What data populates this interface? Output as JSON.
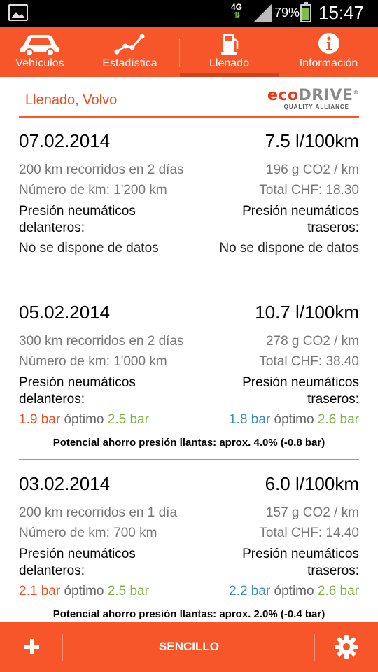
{
  "status_bar": {
    "network": "4G",
    "battery_percent": "79%",
    "battery_level": 0.79,
    "time": "15:47",
    "icons": [
      "image-notification-icon",
      "signal-icon",
      "battery-icon"
    ]
  },
  "nav": {
    "tabs": [
      {
        "label": "Vehículos",
        "icon": "car-icon",
        "active": false
      },
      {
        "label": "Estadística",
        "icon": "line-chart-icon",
        "active": false
      },
      {
        "label": "Llenado",
        "icon": "fuel-pump-icon",
        "active": true
      },
      {
        "label": "Información",
        "icon": "info-icon",
        "active": false
      }
    ]
  },
  "header": {
    "title": "Llenado, Volvo",
    "logo_text_red": "eco",
    "logo_text_grey": "DRIVE",
    "logo_registered": "®",
    "logo_sub": "QUALITY ALLIANCE"
  },
  "entries": [
    {
      "date": "07.02.2014",
      "consumption": "7.5 l/100km",
      "distance": "200 km recorridos en 2 días",
      "co2": "196 g CO2 / km",
      "odometer": "Número de km: 1'200 km",
      "total": "Total CHF: 18.30",
      "front_label_1": "Presión neumáticos",
      "front_label_2": "delanteros:",
      "rear_label_1": "Presión neumáticos",
      "rear_label_2": "traseros:",
      "front_value": "No se dispone de datos",
      "rear_value": "No se dispone de datos"
    },
    {
      "date": "05.02.2014",
      "consumption": "10.7 l/100km",
      "distance": "300 km recorridos en 2 días",
      "co2": "278 g CO2 / km",
      "odometer": "Número de km: 1'000 km",
      "total": "Total CHF: 38.40",
      "front_label_1": "Presión neumáticos",
      "front_label_2": "delanteros:",
      "rear_label_1": "Presión neumáticos",
      "rear_label_2": "traseros:",
      "front_actual": "1.9 bar",
      "front_optimal_word": "óptimo",
      "front_optimal": "2.5 bar",
      "rear_actual": "1.8 bar",
      "rear_optimal_word": "óptimo",
      "rear_optimal": "2.6 bar",
      "savings": "Potencial ahorro presión llantas: aprox. 4.0% (-0.8 bar)"
    },
    {
      "date": "03.02.2014",
      "consumption": "6.0 l/100km",
      "distance": "200 km recorridos en 1 día",
      "co2": "157 g CO2 / km",
      "odometer": "Número de km: 700 km",
      "total": "Total CHF: 14.40",
      "front_label_1": "Presión neumáticos",
      "front_label_2": "delanteros:",
      "rear_label_1": "Presión neumáticos",
      "rear_label_2": "traseros:",
      "front_actual": "2.1 bar",
      "front_optimal_word": "óptimo",
      "front_optimal": "2.5 bar",
      "rear_actual": "2.2 bar",
      "rear_optimal_word": "óptimo",
      "rear_optimal": "2.6 bar",
      "savings": "Potencial ahorro presión llantas: aprox. 2.0% (-0.4 bar)"
    }
  ],
  "bottom_bar": {
    "add_icon": "plus-icon",
    "mode_label": "SENCILLO",
    "settings_icon": "gear-icon"
  },
  "colors": {
    "accent": "#f7552a",
    "accent_dark": "#d4401a",
    "title_red": "#f04d1e",
    "low_pressure": "#f04d1e",
    "rear_pressure": "#3b8fb0",
    "optimal": "#7cb342",
    "secondary_text": "#777777"
  }
}
